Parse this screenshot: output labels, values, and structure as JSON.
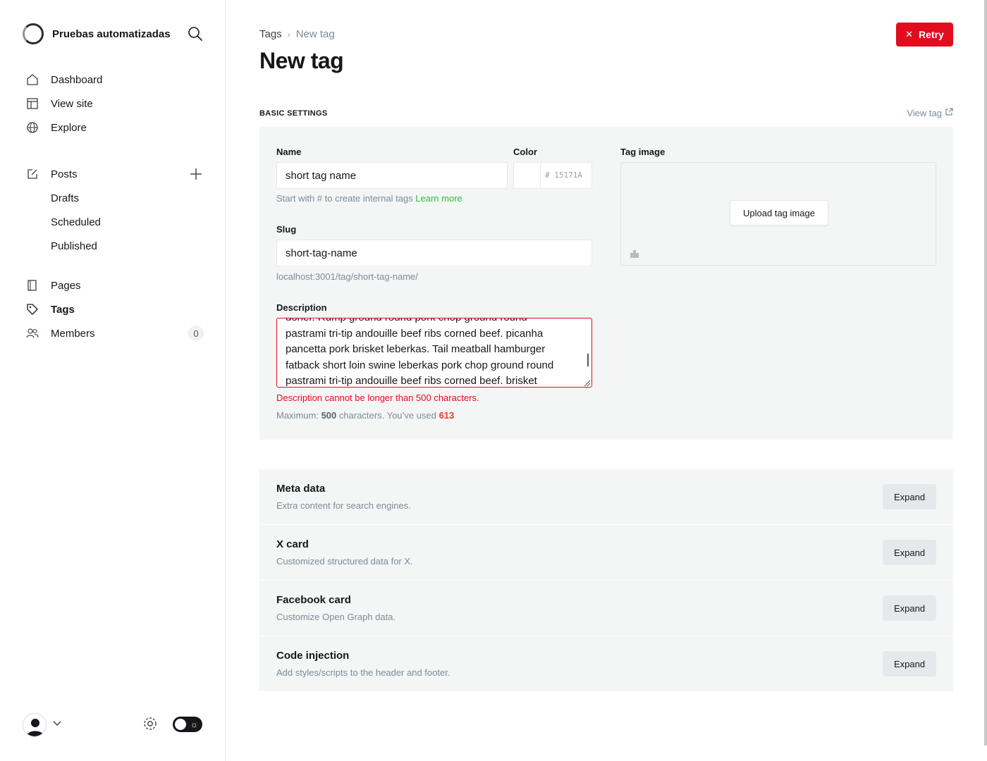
{
  "sidebar": {
    "site_title": "Pruebas automatizadas",
    "nav": {
      "dashboard": "Dashboard",
      "view_site": "View site",
      "explore": "Explore",
      "posts": "Posts",
      "drafts": "Drafts",
      "scheduled": "Scheduled",
      "published": "Published",
      "pages": "Pages",
      "tags": "Tags",
      "members": "Members",
      "members_count": "0"
    }
  },
  "header": {
    "breadcrumb_root": "Tags",
    "breadcrumb_current": "New tag",
    "title": "New tag",
    "retry_label": "Retry"
  },
  "basic": {
    "section_label": "BASIC SETTINGS",
    "view_tag_label": "View tag",
    "name_label": "Name",
    "name_value": "short tag name",
    "name_hint": "Start with # to create internal tags",
    "learn_more": "Learn more",
    "color_label": "Color",
    "color_placeholder": "# 15171A",
    "slug_label": "Slug",
    "slug_value": "short-tag-name",
    "slug_url": "localhost:3001/tag/short-tag-name/",
    "description_label": "Description",
    "description_lines": [
      "doner. Rump ground round pork chop ground round",
      "pastrami tri-tip andouille beef ribs corned beef. picanha",
      "pancetta pork brisket leberkas. Tail meatball hamburger",
      "fatback short loin swine leberkas pork chop ground round",
      "pastrami tri-tip andouille beef ribs corned beef. brisket"
    ],
    "error": "Description cannot be longer than 500 characters.",
    "counter_prefix": "Maximum:",
    "counter_max": "500",
    "counter_mid": "characters. You’ve used",
    "counter_used": "613",
    "tag_image_label": "Tag image",
    "upload_label": "Upload tag image"
  },
  "sections": [
    {
      "title": "Meta data",
      "desc": "Extra content for search engines.",
      "button": "Expand"
    },
    {
      "title": "X card",
      "desc": "Customized structured data for X.",
      "button": "Expand"
    },
    {
      "title": "Facebook card",
      "desc": "Customize Open Graph data.",
      "button": "Expand"
    },
    {
      "title": "Code injection",
      "desc": "Add styles/scripts to the header and footer.",
      "button": "Expand"
    }
  ],
  "colors": {
    "accent_error": "#e30c1f",
    "link_green": "#2cbd3f",
    "text_dark": "#15171a"
  },
  "icons": {
    "search": "search-icon",
    "dashboard": "home-icon",
    "view_site": "layout-icon",
    "explore": "globe-icon",
    "posts": "edit-icon",
    "pages": "page-icon",
    "tags": "tag-icon",
    "members": "members-icon",
    "settings": "gear-icon"
  }
}
